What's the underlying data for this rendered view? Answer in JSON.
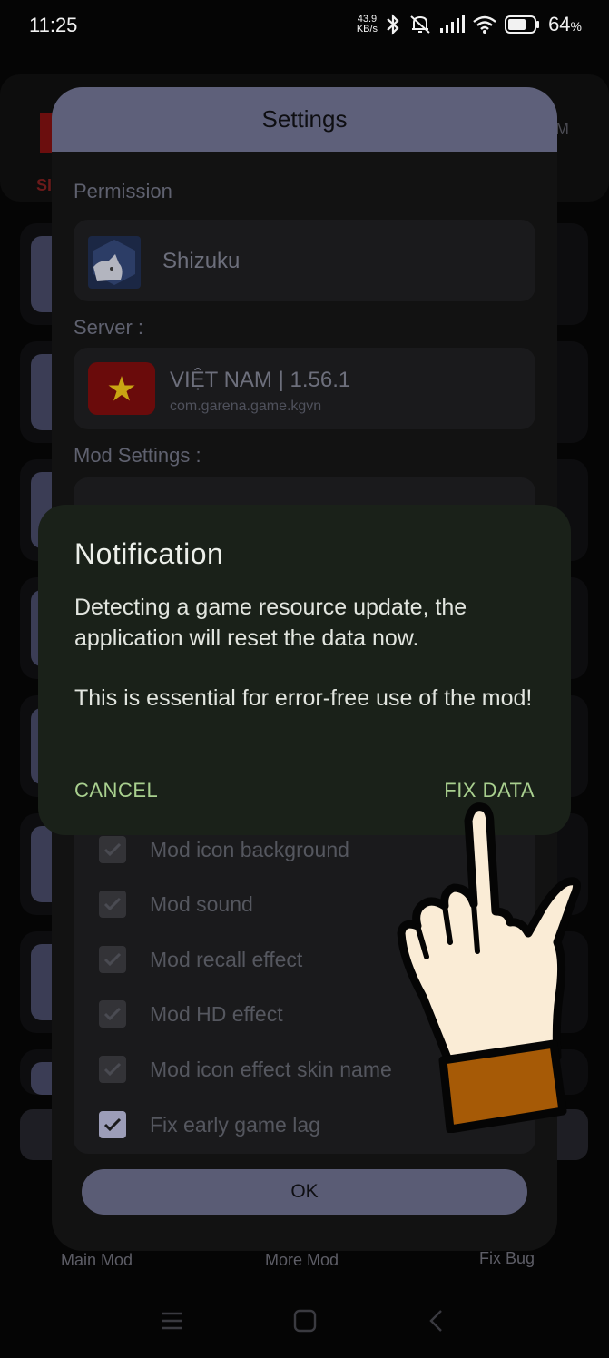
{
  "status_bar": {
    "time": "11:25",
    "net_speed_value": "43.9",
    "net_speed_unit": "KB/s",
    "battery": "64",
    "battery_unit": "%"
  },
  "background_app": {
    "logo_letters": "SI",
    "header_fragment": "M",
    "nav": {
      "main_mod": "Main Mod",
      "more_mod": "More Mod",
      "fix_bug": "Fix Bug"
    }
  },
  "settings": {
    "title": "Settings",
    "permission_label": "Permission",
    "permission_app": "Shizuku",
    "server_label": "Server :",
    "server_name": "VIỆT NAM | 1.56.1",
    "server_package": "com.garena.game.kgvn",
    "mod_settings_label": "Mod Settings :",
    "mods": [
      {
        "label": "Mod icon background",
        "checked": true
      },
      {
        "label": "Mod sound",
        "checked": true
      },
      {
        "label": "Mod recall effect",
        "checked": true
      },
      {
        "label": "Mod HD effect",
        "checked": true
      },
      {
        "label": "Mod icon effect skin name",
        "checked": true
      },
      {
        "label": "Fix early game lag",
        "checked": true
      }
    ],
    "ok_label": "OK"
  },
  "notification": {
    "title": "Notification",
    "message_1": "Detecting a game resource update, the application will reset the data now.",
    "message_2": "This is essential for error-free use of the mod!",
    "cancel_label": "CANCEL",
    "fix_data_label": "FIX DATA"
  },
  "colors": {
    "dialog_header": "#5e607a",
    "notification_bg": "#1a2119",
    "notification_button": "#a9d08f",
    "flag_red": "#6a0b0b",
    "flag_star": "#c9a513"
  }
}
